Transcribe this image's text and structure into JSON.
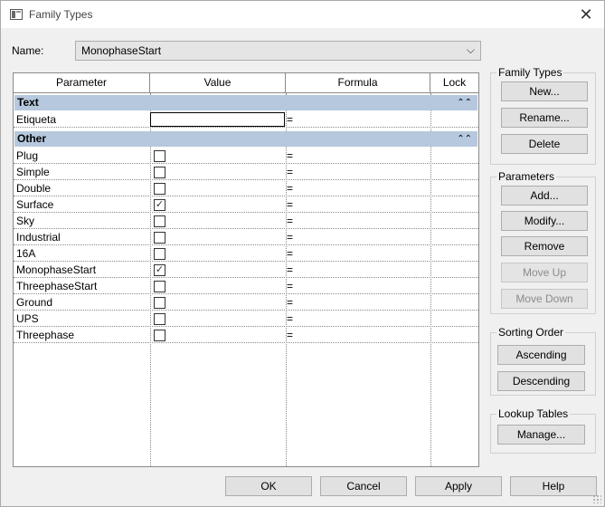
{
  "window": {
    "title": "Family Types"
  },
  "name_field": {
    "label": "Name:",
    "value": "MonophaseStart"
  },
  "grid": {
    "columns": [
      "Parameter",
      "Value",
      "Formula",
      "Lock"
    ],
    "groups": [
      {
        "name": "Text",
        "rows": [
          {
            "parameter": "Etiqueta",
            "type": "text",
            "value": "",
            "formula": "="
          }
        ]
      },
      {
        "name": "Other",
        "rows": [
          {
            "parameter": "Plug",
            "type": "checkbox",
            "checked": false,
            "formula": "="
          },
          {
            "parameter": "Simple",
            "type": "checkbox",
            "checked": false,
            "formula": "="
          },
          {
            "parameter": "Double",
            "type": "checkbox",
            "checked": false,
            "formula": "="
          },
          {
            "parameter": "Surface",
            "type": "checkbox",
            "checked": true,
            "formula": "="
          },
          {
            "parameter": "Sky",
            "type": "checkbox",
            "checked": false,
            "formula": "="
          },
          {
            "parameter": "Industrial",
            "type": "checkbox",
            "checked": false,
            "formula": "="
          },
          {
            "parameter": "16A",
            "type": "checkbox",
            "checked": false,
            "formula": "="
          },
          {
            "parameter": "MonophaseStart",
            "type": "checkbox",
            "checked": true,
            "formula": "="
          },
          {
            "parameter": "ThreephaseStart",
            "type": "checkbox",
            "checked": false,
            "formula": "="
          },
          {
            "parameter": "Ground",
            "type": "checkbox",
            "checked": false,
            "formula": "="
          },
          {
            "parameter": "UPS",
            "type": "checkbox",
            "checked": false,
            "formula": "="
          },
          {
            "parameter": "Threephase",
            "type": "checkbox",
            "checked": false,
            "formula": "="
          }
        ]
      }
    ]
  },
  "family_types": {
    "title": "Family Types",
    "new": "New...",
    "rename": "Rename...",
    "delete": "Delete"
  },
  "parameters": {
    "title": "Parameters",
    "add": "Add...",
    "modify": "Modify...",
    "remove": "Remove",
    "move_up": "Move Up",
    "move_down": "Move Down"
  },
  "sorting": {
    "title": "Sorting Order",
    "ascending": "Ascending",
    "descending": "Descending"
  },
  "lookup": {
    "title": "Lookup Tables",
    "manage": "Manage..."
  },
  "footer": {
    "ok": "OK",
    "cancel": "Cancel",
    "apply": "Apply",
    "help": "Help"
  },
  "icons": {
    "collapse": "collapse-up-icon",
    "close": "close-icon",
    "dropdown": "chevron-down-icon",
    "check": "check-icon"
  },
  "colors": {
    "group_header": "#b5c8dd"
  }
}
